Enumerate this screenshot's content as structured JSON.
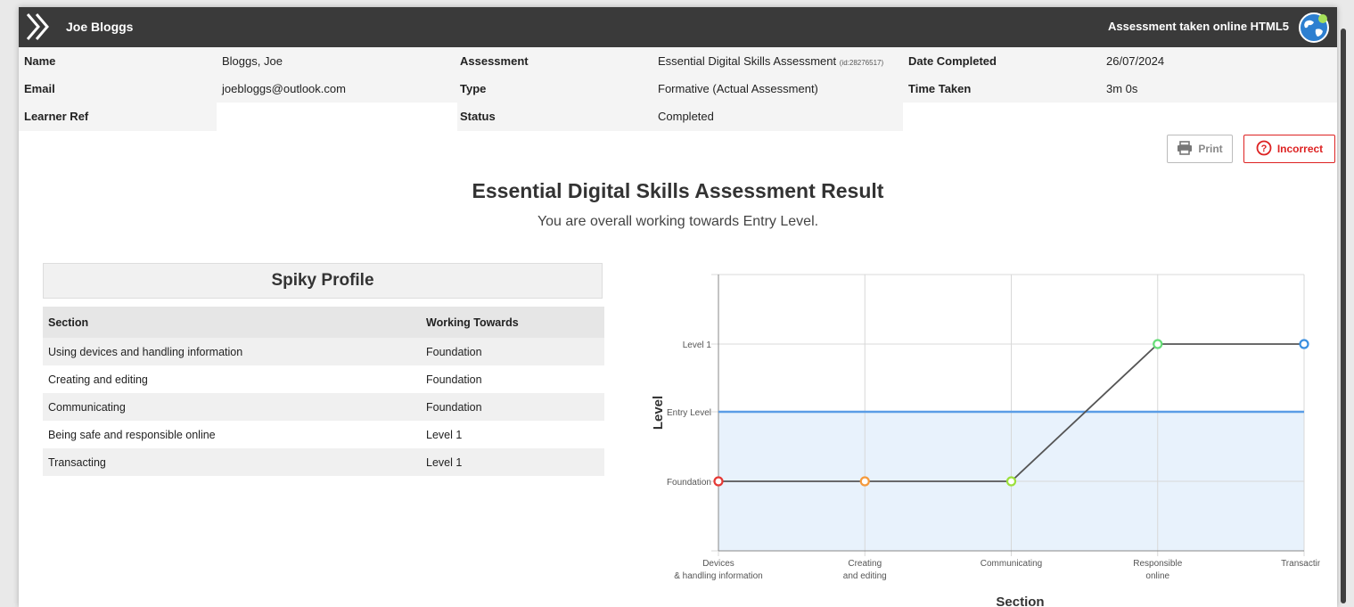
{
  "header": {
    "user_name": "Joe Bloggs",
    "taken_text": "Assessment taken online HTML5",
    "menu_icon": "double-chevron-right-icon",
    "globe_icon": "globe-icon",
    "bg_color": "#3a3a3a"
  },
  "info": {
    "name_label": "Name",
    "name_value": "Bloggs, Joe",
    "email_label": "Email",
    "email_value": "joebloggs@outlook.com",
    "learner_ref_label": "Learner Ref",
    "learner_ref_value": "",
    "assessment_label": "Assessment",
    "assessment_value": "Essential Digital Skills Assessment",
    "assessment_id": "(id:28276517)",
    "type_label": "Type",
    "type_value": "Formative (Actual Assessment)",
    "status_label": "Status",
    "status_value": "Completed",
    "date_label": "Date Completed",
    "date_value": "26/07/2024",
    "time_label": "Time Taken",
    "time_value": "3m 0s"
  },
  "actions": {
    "print_label": "Print",
    "print_icon": "printer-icon",
    "incorrect_label": "Incorrect",
    "incorrect_icon": "question-circle-icon",
    "incorrect_color": "#dd2222"
  },
  "result": {
    "title": "Essential Digital Skills Assessment Result",
    "subtitle": "You are overall working towards Entry Level."
  },
  "spiky": {
    "heading": "Spiky Profile",
    "col_section": "Section",
    "col_working": "Working Towards",
    "rows": [
      {
        "section": "Using devices and handling information",
        "level": "Foundation"
      },
      {
        "section": "Creating and editing",
        "level": "Foundation"
      },
      {
        "section": "Communicating",
        "level": "Foundation"
      },
      {
        "section": "Being safe and responsible online",
        "level": "Level 1"
      },
      {
        "section": "Transacting",
        "level": "Level 1"
      }
    ]
  },
  "chart_data": {
    "type": "line",
    "xlabel": "Section",
    "ylabel": "Level",
    "categories": [
      [
        "Devices",
        "& handling information"
      ],
      [
        "Creating",
        "and editing"
      ],
      [
        "Communicating"
      ],
      [
        "Responsible",
        "online"
      ],
      [
        "Transacting"
      ]
    ],
    "levels": [
      "Foundation",
      "Entry Level",
      "Level 1"
    ],
    "series": [
      {
        "values": [
          "Foundation",
          "Foundation",
          "Foundation",
          "Level 1",
          "Level 1"
        ],
        "point_colors": [
          "#e53935",
          "#f59a3c",
          "#9ce03c",
          "#66dd77",
          "#3a8fe0"
        ]
      }
    ],
    "overall": "Entry Level",
    "overall_color": "#5a9de6",
    "overall_fill": "#e8f2fc",
    "grid": true
  }
}
